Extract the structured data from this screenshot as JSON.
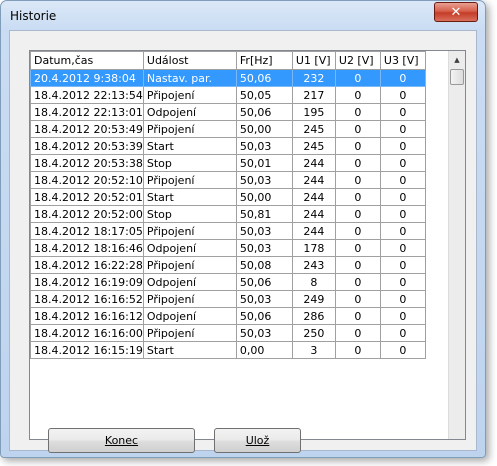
{
  "window": {
    "title": "Historie",
    "close_glyph": "✕"
  },
  "table": {
    "columns": [
      "Datum,čas",
      "Událost",
      "Fr[Hz]",
      "U1 [V]",
      "U2 [V]",
      "U3 [V]"
    ],
    "rows": [
      [
        "20.4.2012 9:38:04",
        "Nastav. par.",
        "50,06",
        "232",
        "0",
        "0"
      ],
      [
        "18.4.2012 22:13:54",
        "Připojení",
        "50,05",
        "217",
        "0",
        "0"
      ],
      [
        "18.4.2012 22:13:01",
        "Odpojení",
        "50,06",
        "195",
        "0",
        "0"
      ],
      [
        "18.4.2012 20:53:49",
        "Připojení",
        "50,00",
        "245",
        "0",
        "0"
      ],
      [
        "18.4.2012 20:53:39",
        "Start",
        "50,03",
        "245",
        "0",
        "0"
      ],
      [
        "18.4.2012 20:53:38",
        "Stop",
        "50,01",
        "244",
        "0",
        "0"
      ],
      [
        "18.4.2012 20:52:10",
        "Připojení",
        "50,03",
        "244",
        "0",
        "0"
      ],
      [
        "18.4.2012 20:52:01",
        "Start",
        "50,00",
        "244",
        "0",
        "0"
      ],
      [
        "18.4.2012 20:52:00",
        "Stop",
        "50,81",
        "244",
        "0",
        "0"
      ],
      [
        "18.4.2012 18:17:05",
        "Připojení",
        "50,03",
        "244",
        "0",
        "0"
      ],
      [
        "18.4.2012 18:16:46",
        "Odpojení",
        "50,03",
        "178",
        "0",
        "0"
      ],
      [
        "18.4.2012 16:22:28",
        "Připojení",
        "50,08",
        "243",
        "0",
        "0"
      ],
      [
        "18.4.2012 16:19:09",
        "Odpojení",
        "50,06",
        "8",
        "0",
        "0"
      ],
      [
        "18.4.2012 16:16:52",
        "Připojení",
        "50,03",
        "249",
        "0",
        "0"
      ],
      [
        "18.4.2012 16:16:12",
        "Odpojení",
        "50,06",
        "286",
        "0",
        "0"
      ],
      [
        "18.4.2012 16:16:00",
        "Připojení",
        "50,03",
        "250",
        "0",
        "0"
      ],
      [
        "18.4.2012 16:15:19",
        "Start",
        "0,00",
        "3",
        "0",
        "0"
      ]
    ],
    "selected_row": 0,
    "scroll_up_glyph": "▲"
  },
  "buttons": {
    "konec": "Konec",
    "uloz": "Ulož"
  },
  "colors": {
    "selection": "#3399ff",
    "close_button": "#c43c28"
  }
}
